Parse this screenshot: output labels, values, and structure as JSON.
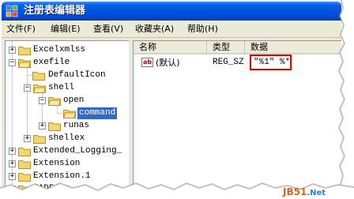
{
  "window": {
    "title": "注册表编辑器"
  },
  "menu": [
    {
      "label": "文件(F)"
    },
    {
      "label": "编辑(E)"
    },
    {
      "label": "查看(V)"
    },
    {
      "label": "收藏夹(A)"
    },
    {
      "label": "帮助(H)"
    }
  ],
  "tree": {
    "nodes": [
      {
        "label": "Excelxmlss",
        "expander": "+"
      },
      {
        "label": "exefile",
        "expander": "−"
      },
      {
        "label": "DefaultIcon",
        "expander": ""
      },
      {
        "label": "shell",
        "expander": "−"
      },
      {
        "label": "open",
        "expander": "−"
      },
      {
        "label": "command",
        "expander": "",
        "selected": true
      },
      {
        "label": "runas",
        "expander": "+"
      },
      {
        "label": "shellex",
        "expander": "+"
      },
      {
        "label": "Extended_Logging_",
        "expander": "+"
      },
      {
        "label": "Extension",
        "expander": "+"
      },
      {
        "label": "Extension.1",
        "expander": "+"
      },
      {
        "label": "FADFile",
        "expander": "+"
      }
    ]
  },
  "list": {
    "columns": [
      "名称",
      "类型",
      "数据"
    ],
    "rows": [
      {
        "name": "(默认)",
        "type": "REG_SZ",
        "data": "\"%1\" %*",
        "icon": "ab-string-icon"
      }
    ]
  },
  "annotation": {
    "highlight_color": "#e60000"
  },
  "watermark": {
    "brand": "JB51",
    "tld": ".Net"
  },
  "colors": {
    "titlebar": "#0054e3",
    "selection": "#316ac5",
    "chrome": "#ece9d8"
  }
}
